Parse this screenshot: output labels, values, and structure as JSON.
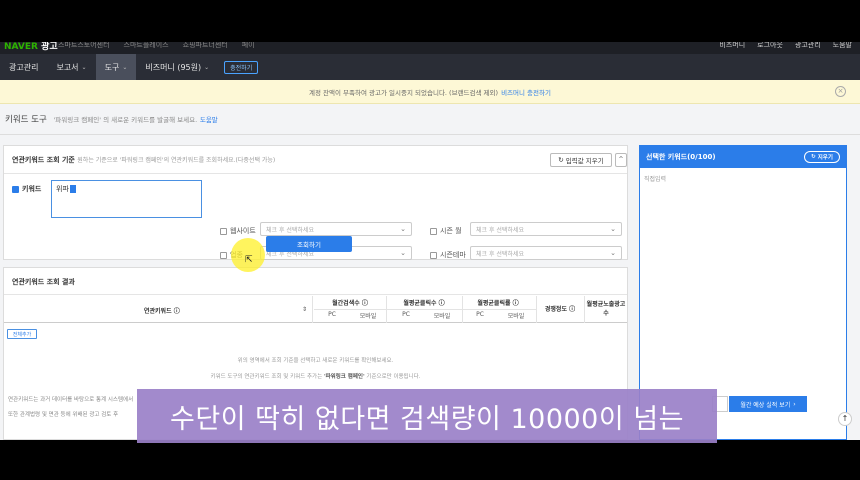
{
  "topstrip": {
    "brand_prefix": "NAVER",
    "brand_suffix": "광고",
    "nav": [
      "스마트스토어센터",
      "스마트플레이스",
      "쇼핑파트너센터",
      "페이"
    ],
    "right": [
      "비즈머니",
      "로그아웃",
      "광고관리",
      "도움말"
    ]
  },
  "navbar": {
    "items": [
      "광고관리",
      "보고서",
      "도구",
      "비즈머니 (95원)"
    ],
    "charge_label": "충전하기"
  },
  "notice": {
    "text": "계정 잔액이 부족하여 광고가 일시중지 되었습니다. (브랜드검색 제외)",
    "link": "비즈머니 충전하기",
    "close": "×"
  },
  "page": {
    "title": "키워드 도구",
    "desc": "'파워링크 캠페인' 의 새로운 키워드를 발굴해 보세요.",
    "help": "도움말"
  },
  "search": {
    "title": "연관키워드 조회 기준",
    "desc": "원하는 기준으로 '파워링크 캠페인'의 연관키워드를 조회하세요.(다중선택 가능)",
    "reset_label": "입력값 지우기",
    "collapse": "^",
    "keyword_label": "키워드",
    "keyword_value": "위파",
    "website_label": "웹사이트",
    "season_month_label": "시즌 월",
    "industry_label": "업종",
    "season_theme_label": "시즌테마",
    "select_placeholder": "체크 후 선택하세요",
    "query_button": "조회하기"
  },
  "results": {
    "title": "연관키워드 조회 결과",
    "add_all": "전체추가",
    "columns": {
      "keyword": "연관키워드",
      "monthly_search": "월간검색수",
      "monthly_click": "월평균클릭수",
      "monthly_ctr": "월평균클릭률",
      "competition": "경쟁정도",
      "ad_count": "월평균노출광고수",
      "pc": "PC",
      "mobile": "모바일"
    },
    "empty_line1": "위의 영역에서 조회 기준을 선택하고 새로운 키워드를 확인해보세요.",
    "empty_line2_pre": "키워드 도구의 연관키워드 조회 및 키워드 추가는",
    "empty_line2_strong": "'파워링크 캠페인'",
    "empty_line2_post": "기준으로만 이용됩니다.",
    "footnote1": "연관키워드는 과거 데이터를 바탕으로 통계 시스템에서",
    "footnote2": "또한 관계법령 및 면관 등에 위배된 광고 검토 후"
  },
  "selected": {
    "title": "선택한 키워드(0/100)",
    "reset": "지우기",
    "direct_input": "직접입력",
    "estimate_button": "월간 예상 실적 보기"
  },
  "scroll_top": "↑",
  "subtitle": "수단이 딱히 없다면 검색량이 10000이 넘는",
  "colors": {
    "accent": "#2b7de9",
    "nav_bg": "#2a2d36",
    "notice_bg": "#fdf8d6",
    "subtitle_bg": "#9a80c8",
    "highlight": "#fff028"
  }
}
